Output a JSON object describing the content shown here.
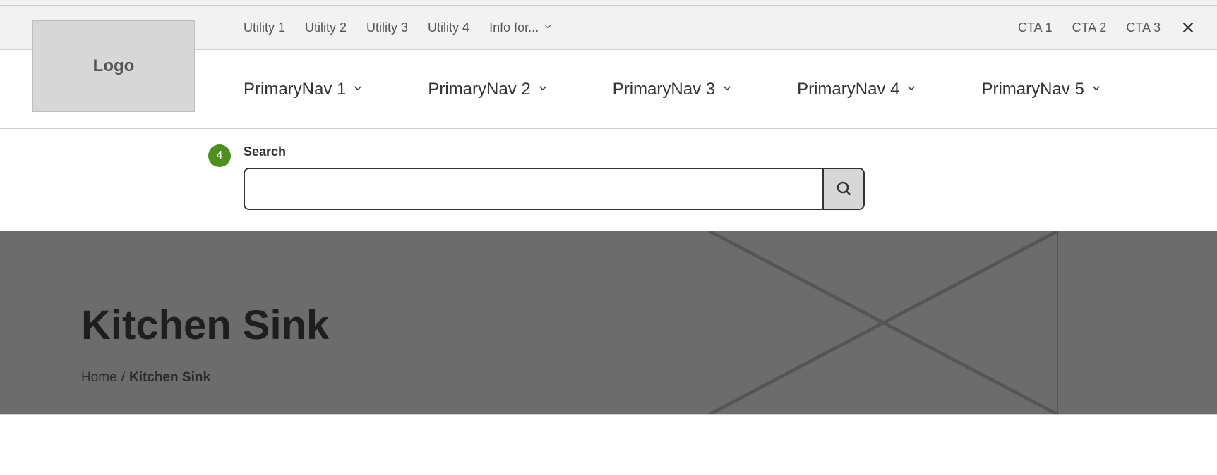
{
  "utility": {
    "items": [
      "Utility 1",
      "Utility 2",
      "Utility 3",
      "Utility 4"
    ],
    "info_label": "Info for..."
  },
  "cta": {
    "items": [
      "CTA 1",
      "CTA 2",
      "CTA 3"
    ]
  },
  "logo": {
    "label": "Logo"
  },
  "primary_nav": {
    "items": [
      "PrimaryNav 1",
      "PrimaryNav 2",
      "PrimaryNav 3",
      "PrimaryNav 4",
      "PrimaryNav 5"
    ]
  },
  "search": {
    "badge": "4",
    "label": "Search",
    "value": "",
    "placeholder": ""
  },
  "hero": {
    "title": "Kitchen Sink",
    "breadcrumb_home": "Home",
    "breadcrumb_sep": "/",
    "breadcrumb_current": "Kitchen Sink"
  }
}
